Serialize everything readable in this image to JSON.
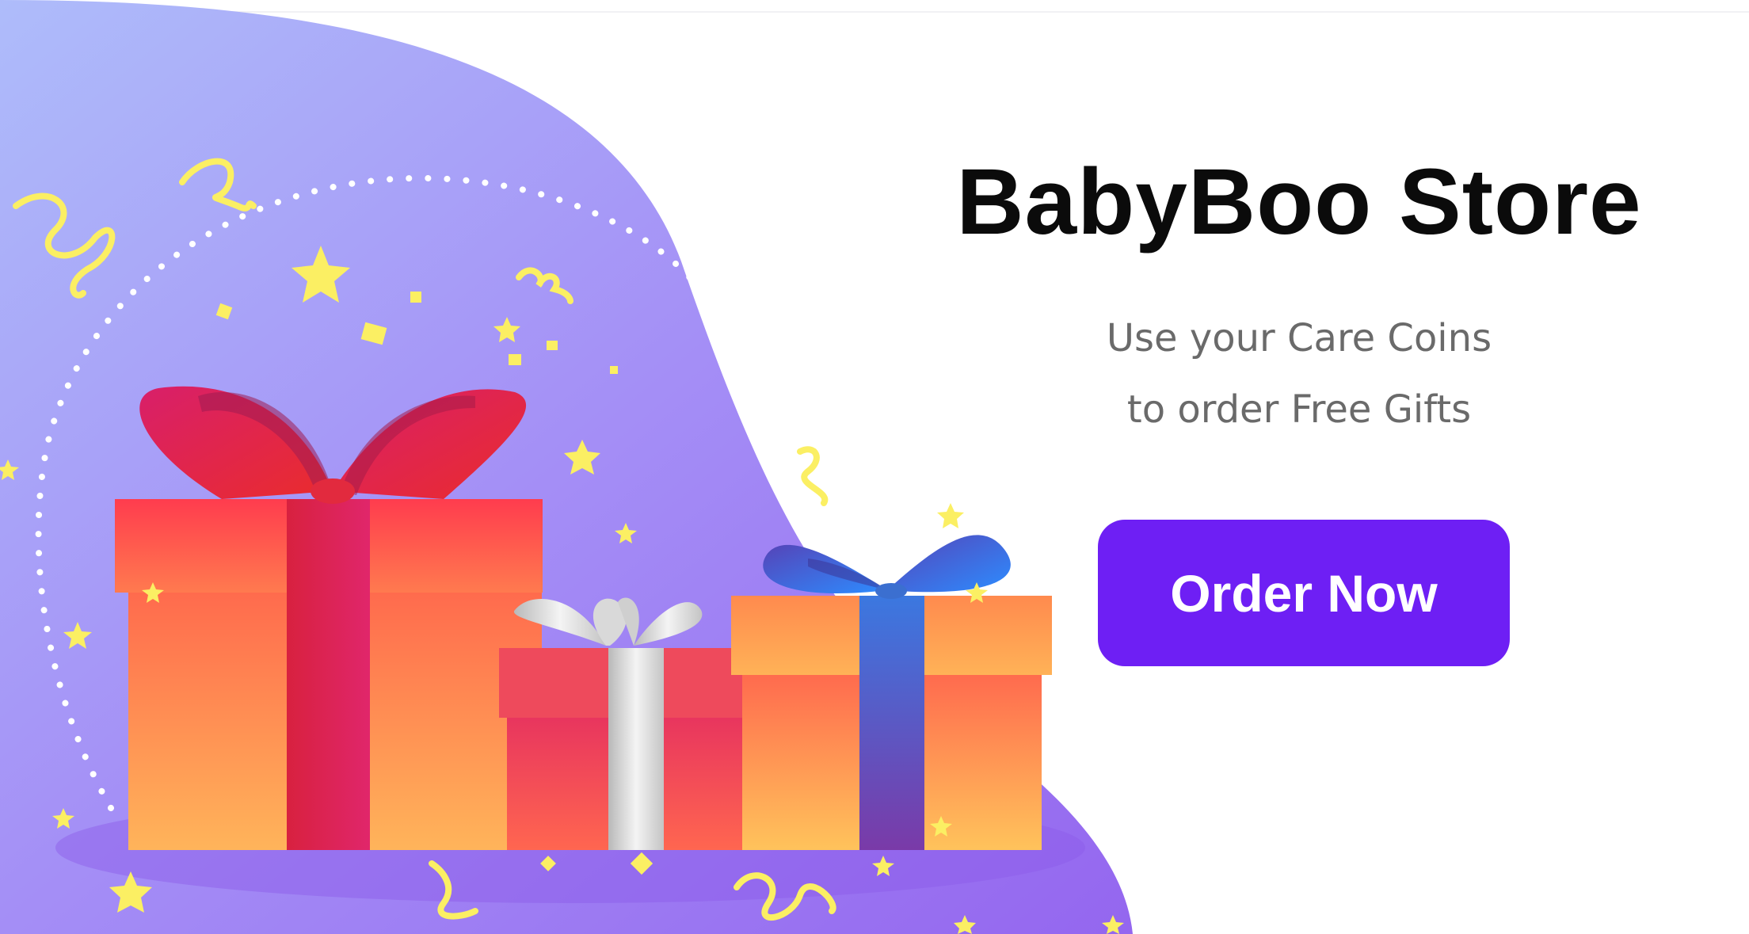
{
  "store": {
    "title": "BabyBoo Store",
    "subtitle_line1": "Use your Care Coins",
    "subtitle_line2": "to order Free Gifts",
    "button_label": "Order Now"
  },
  "colors": {
    "background": "#ffffff",
    "blob_start": "#a9b6fb",
    "blob_end": "#9a6ff2",
    "title": "#0b0b0b",
    "subtitle": "#6a6a6a",
    "button": "#6e1ff4",
    "button_text": "#ffffff",
    "confetti": "#fbef63"
  },
  "icons": {
    "big_gift": "gift-red-ribbon",
    "medium_gift": "gift-silver-ribbon",
    "small_gift": "gift-blue-ribbon"
  }
}
